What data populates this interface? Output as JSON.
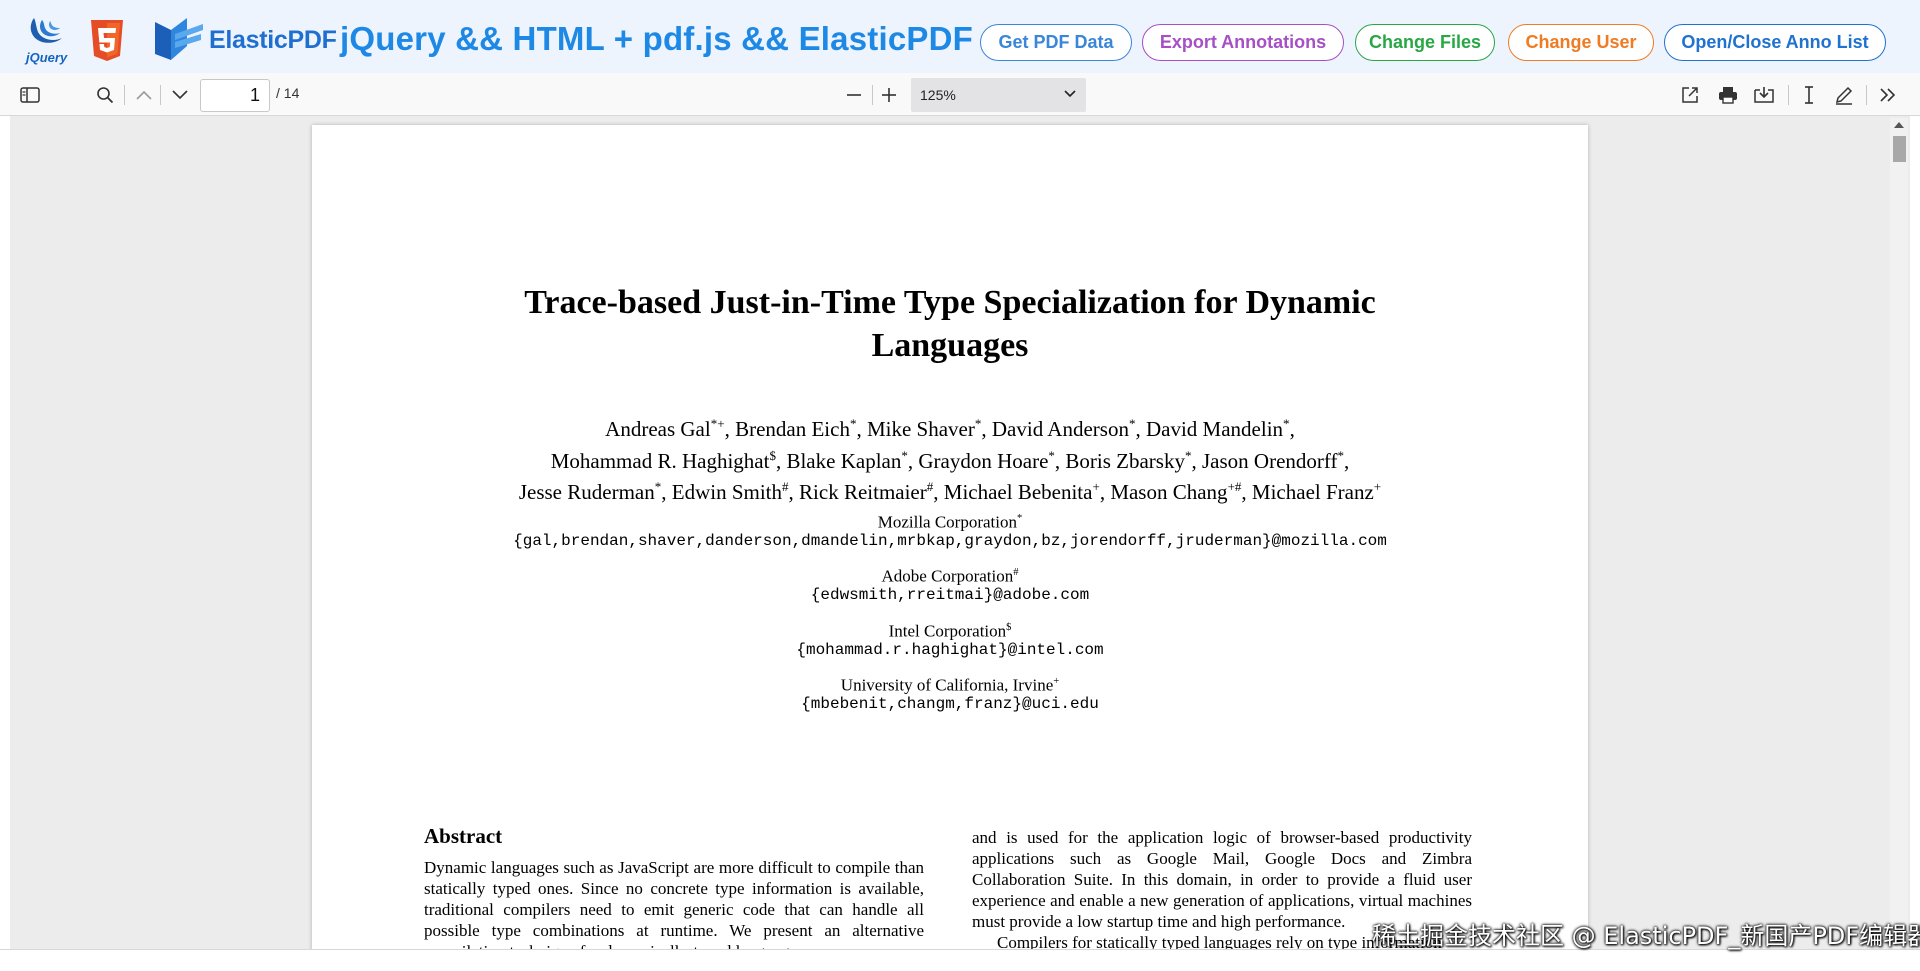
{
  "header": {
    "jquery_logo_text": "jQuery",
    "elastic_logo_text": "ElasticPDF",
    "title": "jQuery && HTML + pdf.js && ElasticPDF",
    "buttons": [
      {
        "label": "Get PDF Data",
        "color": "#3a86d8"
      },
      {
        "label": "Export Annotations",
        "color": "#a64fc6"
      },
      {
        "label": "Change Files",
        "color": "#28a745"
      },
      {
        "label": "Change User",
        "color": "#ef7b22"
      },
      {
        "label": "Open/Close Anno List",
        "color": "#1f72cf"
      }
    ]
  },
  "toolbar": {
    "page_number": "1",
    "page_total": "/ 14",
    "zoom": "125%"
  },
  "paper": {
    "title_line1": "Trace-based Just-in-Time Type Specialization for Dynamic",
    "title_line2": "Languages",
    "authors_line1": "Andreas Gal*+, Brendan Eich*, Mike Shaver*, David Anderson*, David Mandelin*,",
    "authors_line2": "Mohammad R. Haghighat$, Blake Kaplan*, Graydon Hoare*, Boris Zbarsky*, Jason Orendorff*,",
    "authors_line3": "Jesse Ruderman*, Edwin Smith#, Rick Reitmaier#, Michael Bebenita+, Mason Chang+#, Michael Franz+",
    "affiliations": [
      {
        "name": "Mozilla Corporation",
        "mark": "*",
        "mail": "{gal,brendan,shaver,danderson,dmandelin,mrbkap,graydon,bz,jorendorff,jruderman}@mozilla.com"
      },
      {
        "name": "Adobe Corporation",
        "mark": "#",
        "mail": "{edwsmith,rreitmai}@adobe.com"
      },
      {
        "name": "Intel Corporation",
        "mark": "$",
        "mail": "{mohammad.r.haghighat}@intel.com"
      },
      {
        "name": "University of California, Irvine",
        "mark": "+",
        "mail": "{mbebenit,changm,franz}@uci.edu"
      }
    ],
    "abstract_heading": "Abstract",
    "col1_text": "Dynamic languages such as JavaScript are more difficult to compile than statically typed ones. Since no concrete type information is available, traditional compilers need to emit generic code that can handle all possible type combinations at runtime. We present an alternative compilation technique for dynamically-typed languages",
    "col2_text": "and is used for the application logic of browser-based productivity applications such as Google Mail, Google Docs and Zimbra Collaboration Suite. In this domain, in order to provide a fluid user experience and enable a new generation of applications, virtual machines must provide a low startup time and high performance.",
    "col2_text2": "Compilers for statically typed languages rely on type information"
  },
  "watermark": "稀土掘金技术社区 @ ElasticPDF_新国产PDF编辑器"
}
